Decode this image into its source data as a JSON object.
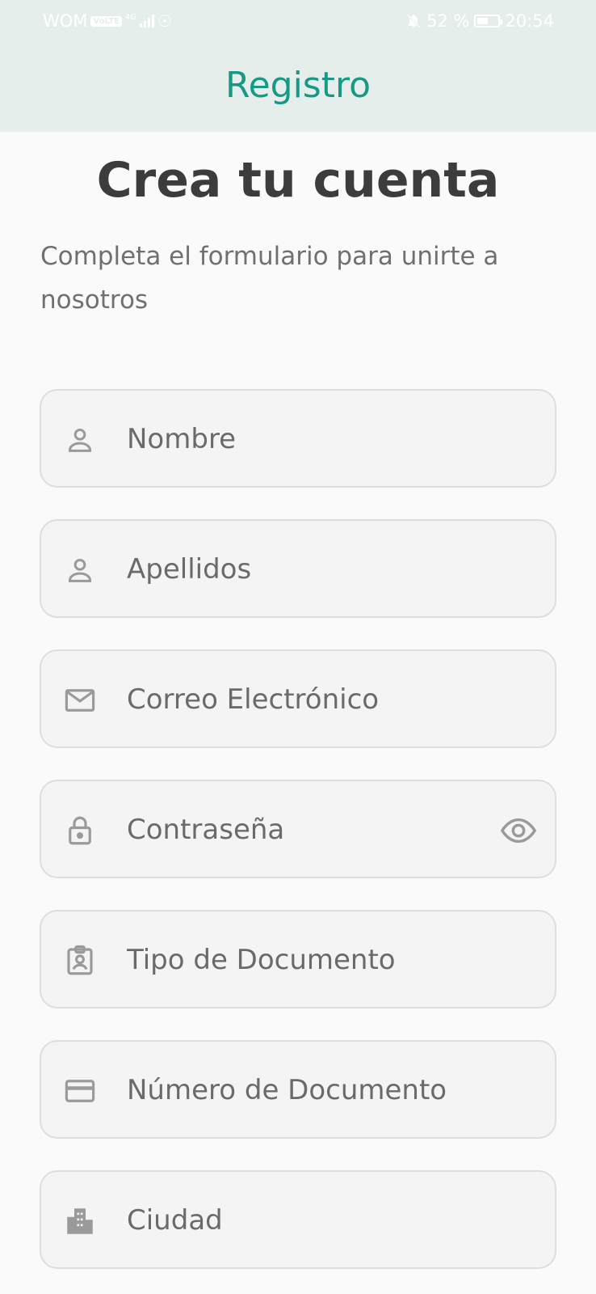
{
  "status_bar": {
    "carrier": "WOM",
    "network": "4G",
    "battery": "52 %",
    "time": "20:54"
  },
  "app_bar": {
    "title": "Registro"
  },
  "heading": "Crea tu cuenta",
  "subtitle": "Completa el formulario para unirte a nosotros",
  "form": {
    "nombre": {
      "placeholder": "Nombre",
      "icon": "person-icon"
    },
    "apellidos": {
      "placeholder": "Apellidos",
      "icon": "person-icon"
    },
    "correo": {
      "placeholder": "Correo Electrónico",
      "icon": "mail-icon"
    },
    "contrasena": {
      "placeholder": "Contraseña",
      "icon": "lock-icon",
      "trailing_icon": "eye-icon"
    },
    "tipo_documento": {
      "placeholder": "Tipo de Documento",
      "icon": "id-badge-icon"
    },
    "numero_documento": {
      "placeholder": "Número de Documento",
      "icon": "card-icon"
    },
    "ciudad": {
      "placeholder": "Ciudad",
      "icon": "city-icon"
    }
  },
  "colors": {
    "accent": "#169a86",
    "appbar_bg": "#e6eeec",
    "field_bg": "#f4f4f4",
    "field_border": "#dedede",
    "icon": "#9a9a9a"
  }
}
